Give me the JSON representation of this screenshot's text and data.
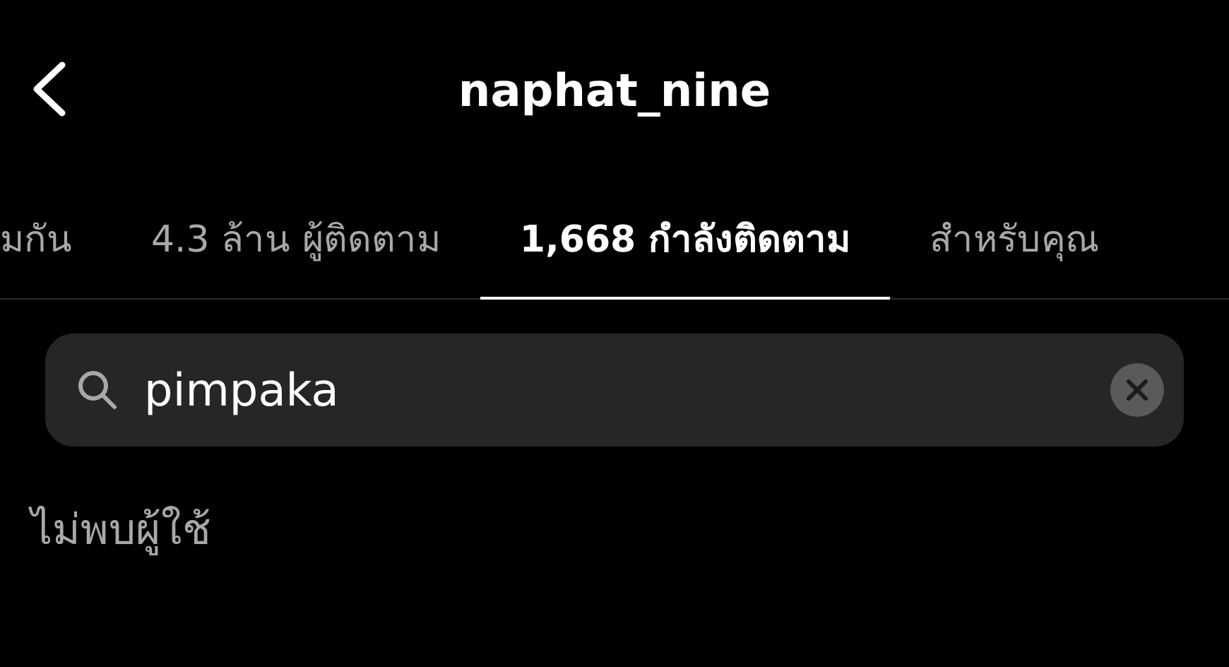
{
  "header": {
    "title": "naphat_nine"
  },
  "tabs": [
    {
      "label": "มกัน",
      "selected": false
    },
    {
      "label": "4.3 ล้าน ผู้ติดตาม",
      "selected": false
    },
    {
      "label": "1,668 กำลังติดตาม",
      "selected": true
    },
    {
      "label": "สำหรับคุณ",
      "selected": false
    }
  ],
  "search": {
    "value": "pimpaka"
  },
  "message": "ไม่พบผู้ใช้"
}
